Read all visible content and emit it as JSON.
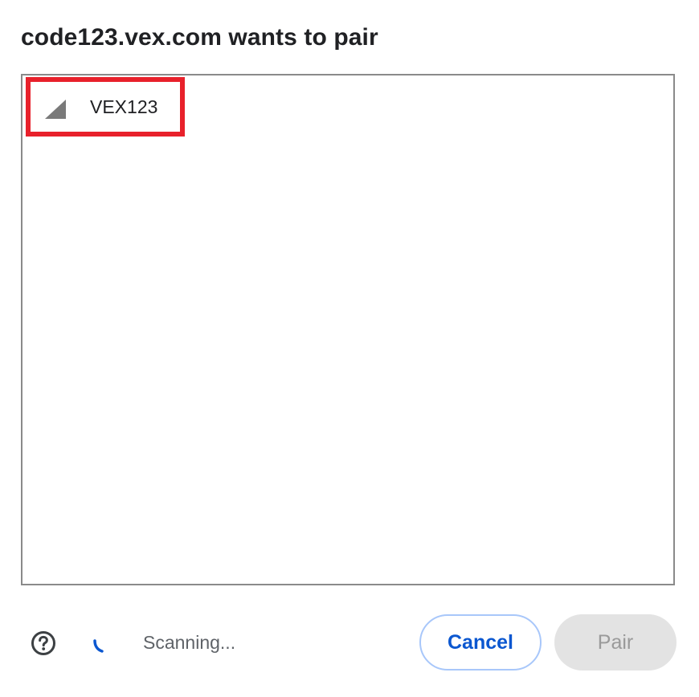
{
  "dialog": {
    "title": "code123.vex.com wants to pair"
  },
  "device_list": {
    "items": [
      {
        "name": "VEX123",
        "icon": "signal-strength-icon",
        "selected": true
      }
    ]
  },
  "footer": {
    "help_icon": "help-circle-icon",
    "spinner_icon": "loading-spinner-icon",
    "status": "Scanning...",
    "cancel_label": "Cancel",
    "pair_label": "Pair"
  },
  "colors": {
    "accent": "#0b57d0",
    "highlight_border": "#e8212b",
    "cancel_border": "#a8c7fa",
    "disabled_bg": "#e3e3e3"
  }
}
